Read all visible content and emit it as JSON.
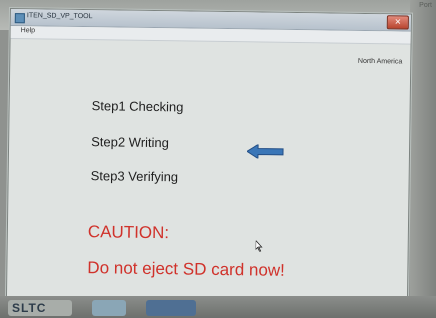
{
  "window": {
    "title": "ITEN_SD_VP_TOOL",
    "menu": {
      "help": "Help"
    },
    "region": "North America",
    "steps": [
      {
        "label": "Step1 Checking"
      },
      {
        "label": "Step2 Writing"
      },
      {
        "label": "Step3 Verifying"
      }
    ],
    "current_step_index": 2,
    "caution_title": "CAUTION:",
    "caution_message": "Do not eject SD card now!"
  },
  "taskbar": {
    "items": [
      {
        "label": "SLTC"
      }
    ]
  },
  "corner_label": "Port",
  "colors": {
    "caution": "#d0322b",
    "arrow": "#3a76b7"
  },
  "icons": {
    "current_step_indicator": "arrow-left-icon",
    "mouse_pointer": "cursor-icon",
    "close": "close-icon"
  }
}
